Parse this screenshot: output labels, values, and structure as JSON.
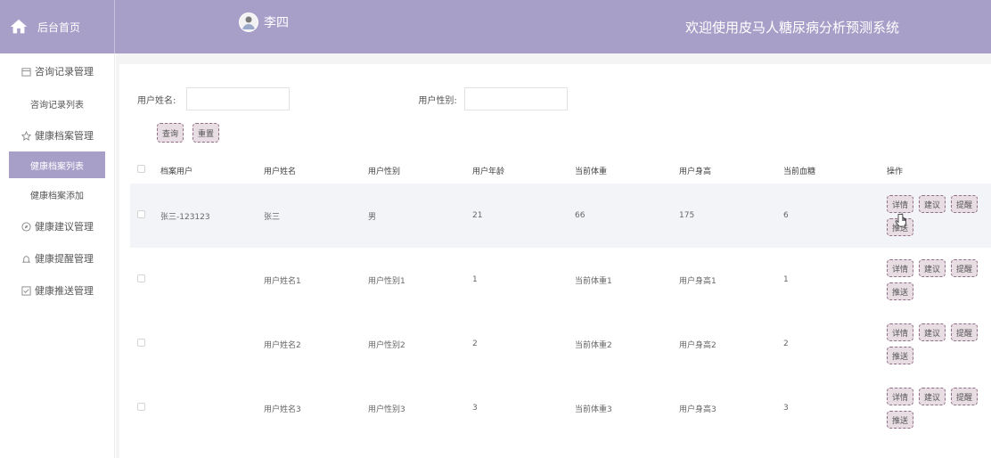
{
  "header": {
    "home_label": "后台首页",
    "username": "李四",
    "site_title": "欢迎使用皮马人糖尿病分析预测系统",
    "accent": "#a89fc9"
  },
  "sidebar": {
    "groups": [
      {
        "label": "咨询记录管理",
        "icon": "calendar-icon",
        "items": [
          {
            "label": "咨询记录列表",
            "active": false
          }
        ]
      },
      {
        "label": "健康档案管理",
        "icon": "star-icon",
        "items": [
          {
            "label": "健康档案列表",
            "active": true
          },
          {
            "label": "健康档案添加",
            "active": false
          }
        ]
      },
      {
        "label": "健康建议管理",
        "icon": "compass-icon",
        "items": []
      },
      {
        "label": "健康提醒管理",
        "icon": "bell-icon",
        "items": []
      },
      {
        "label": "健康推送管理",
        "icon": "check-icon",
        "items": []
      }
    ]
  },
  "search": {
    "name_label": "用户姓名:",
    "gender_label": "用户性别:",
    "query_label": "查询",
    "reset_label": "重置"
  },
  "table": {
    "columns": [
      "档案用户",
      "用户姓名",
      "用户性别",
      "用户年龄",
      "当前体重",
      "用户身高",
      "当前血糖",
      "操作"
    ],
    "actions": [
      "详情",
      "建议",
      "提醒",
      "推送"
    ],
    "rows": [
      [
        "张三-123123",
        "张三",
        "男",
        "21",
        "66",
        "175",
        "6"
      ],
      [
        "",
        "用户姓名1",
        "用户性别1",
        "1",
        "当前体重1",
        "用户身高1",
        "1"
      ],
      [
        "",
        "用户姓名2",
        "用户性别2",
        "2",
        "当前体重2",
        "用户身高2",
        "2"
      ],
      [
        "",
        "用户姓名3",
        "用户性别3",
        "3",
        "当前体重3",
        "用户身高3",
        "3"
      ]
    ]
  }
}
